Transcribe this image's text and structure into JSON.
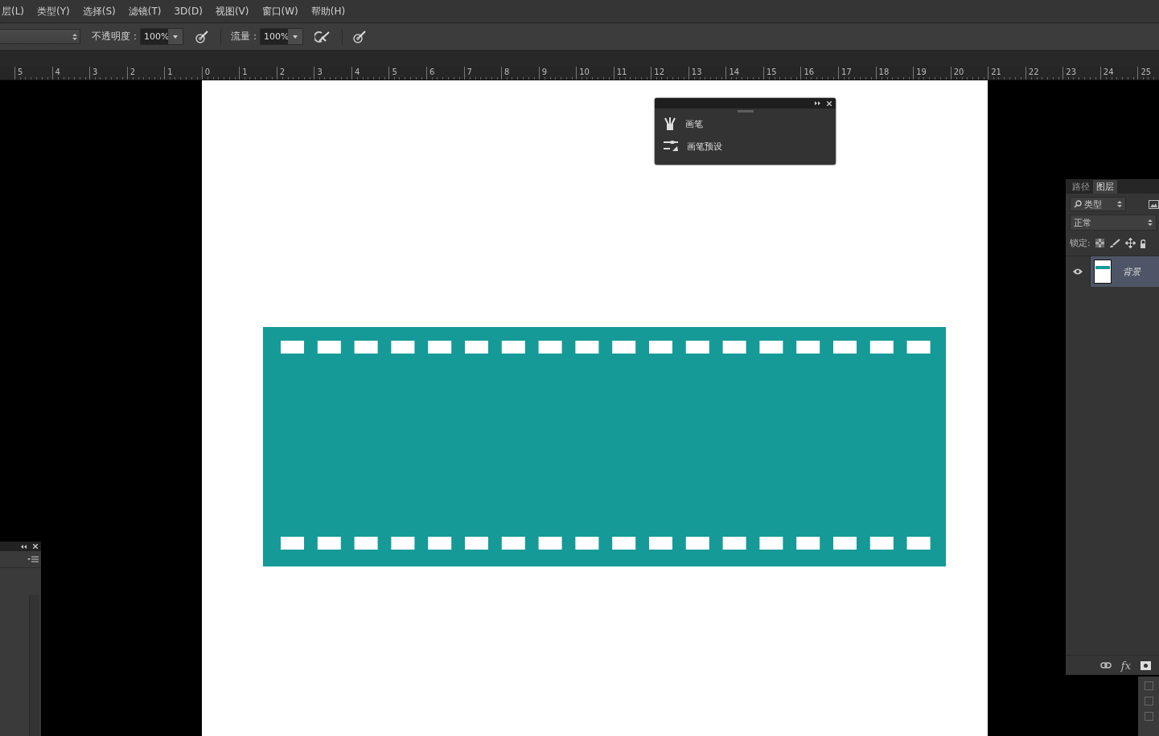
{
  "menu": [
    "层(L)",
    "类型(Y)",
    "选择(S)",
    "滤镜(T)",
    "3D(D)",
    "视图(V)",
    "窗口(W)",
    "帮助(H)"
  ],
  "options_bar": {
    "opacity": {
      "label": "不透明度：",
      "value": "100%"
    },
    "flow": {
      "label": "流量：",
      "value": "100%"
    }
  },
  "ruler": [
    "5",
    "4",
    "3",
    "2",
    "1",
    "0",
    "1",
    "2",
    "3",
    "4",
    "5",
    "6",
    "7",
    "8",
    "9",
    "10",
    "11",
    "12",
    "13",
    "14",
    "15",
    "16",
    "17",
    "18",
    "19",
    "20",
    "21",
    "22",
    "23",
    "24",
    "25"
  ],
  "brush_panel": {
    "items": [
      {
        "label": "画笔",
        "kind": "brush"
      },
      {
        "label": "画笔预设",
        "kind": "preset"
      }
    ]
  },
  "layers_panel": {
    "tabs": [
      {
        "label": "路径",
        "selected": false
      },
      {
        "label": "图层",
        "selected": true
      }
    ],
    "filter": "类型",
    "blend_mode": "正常",
    "lock_label": "锁定:",
    "layers": [
      {
        "name": "背景",
        "selected": true,
        "visible": true
      }
    ],
    "footer_label": "fx"
  }
}
